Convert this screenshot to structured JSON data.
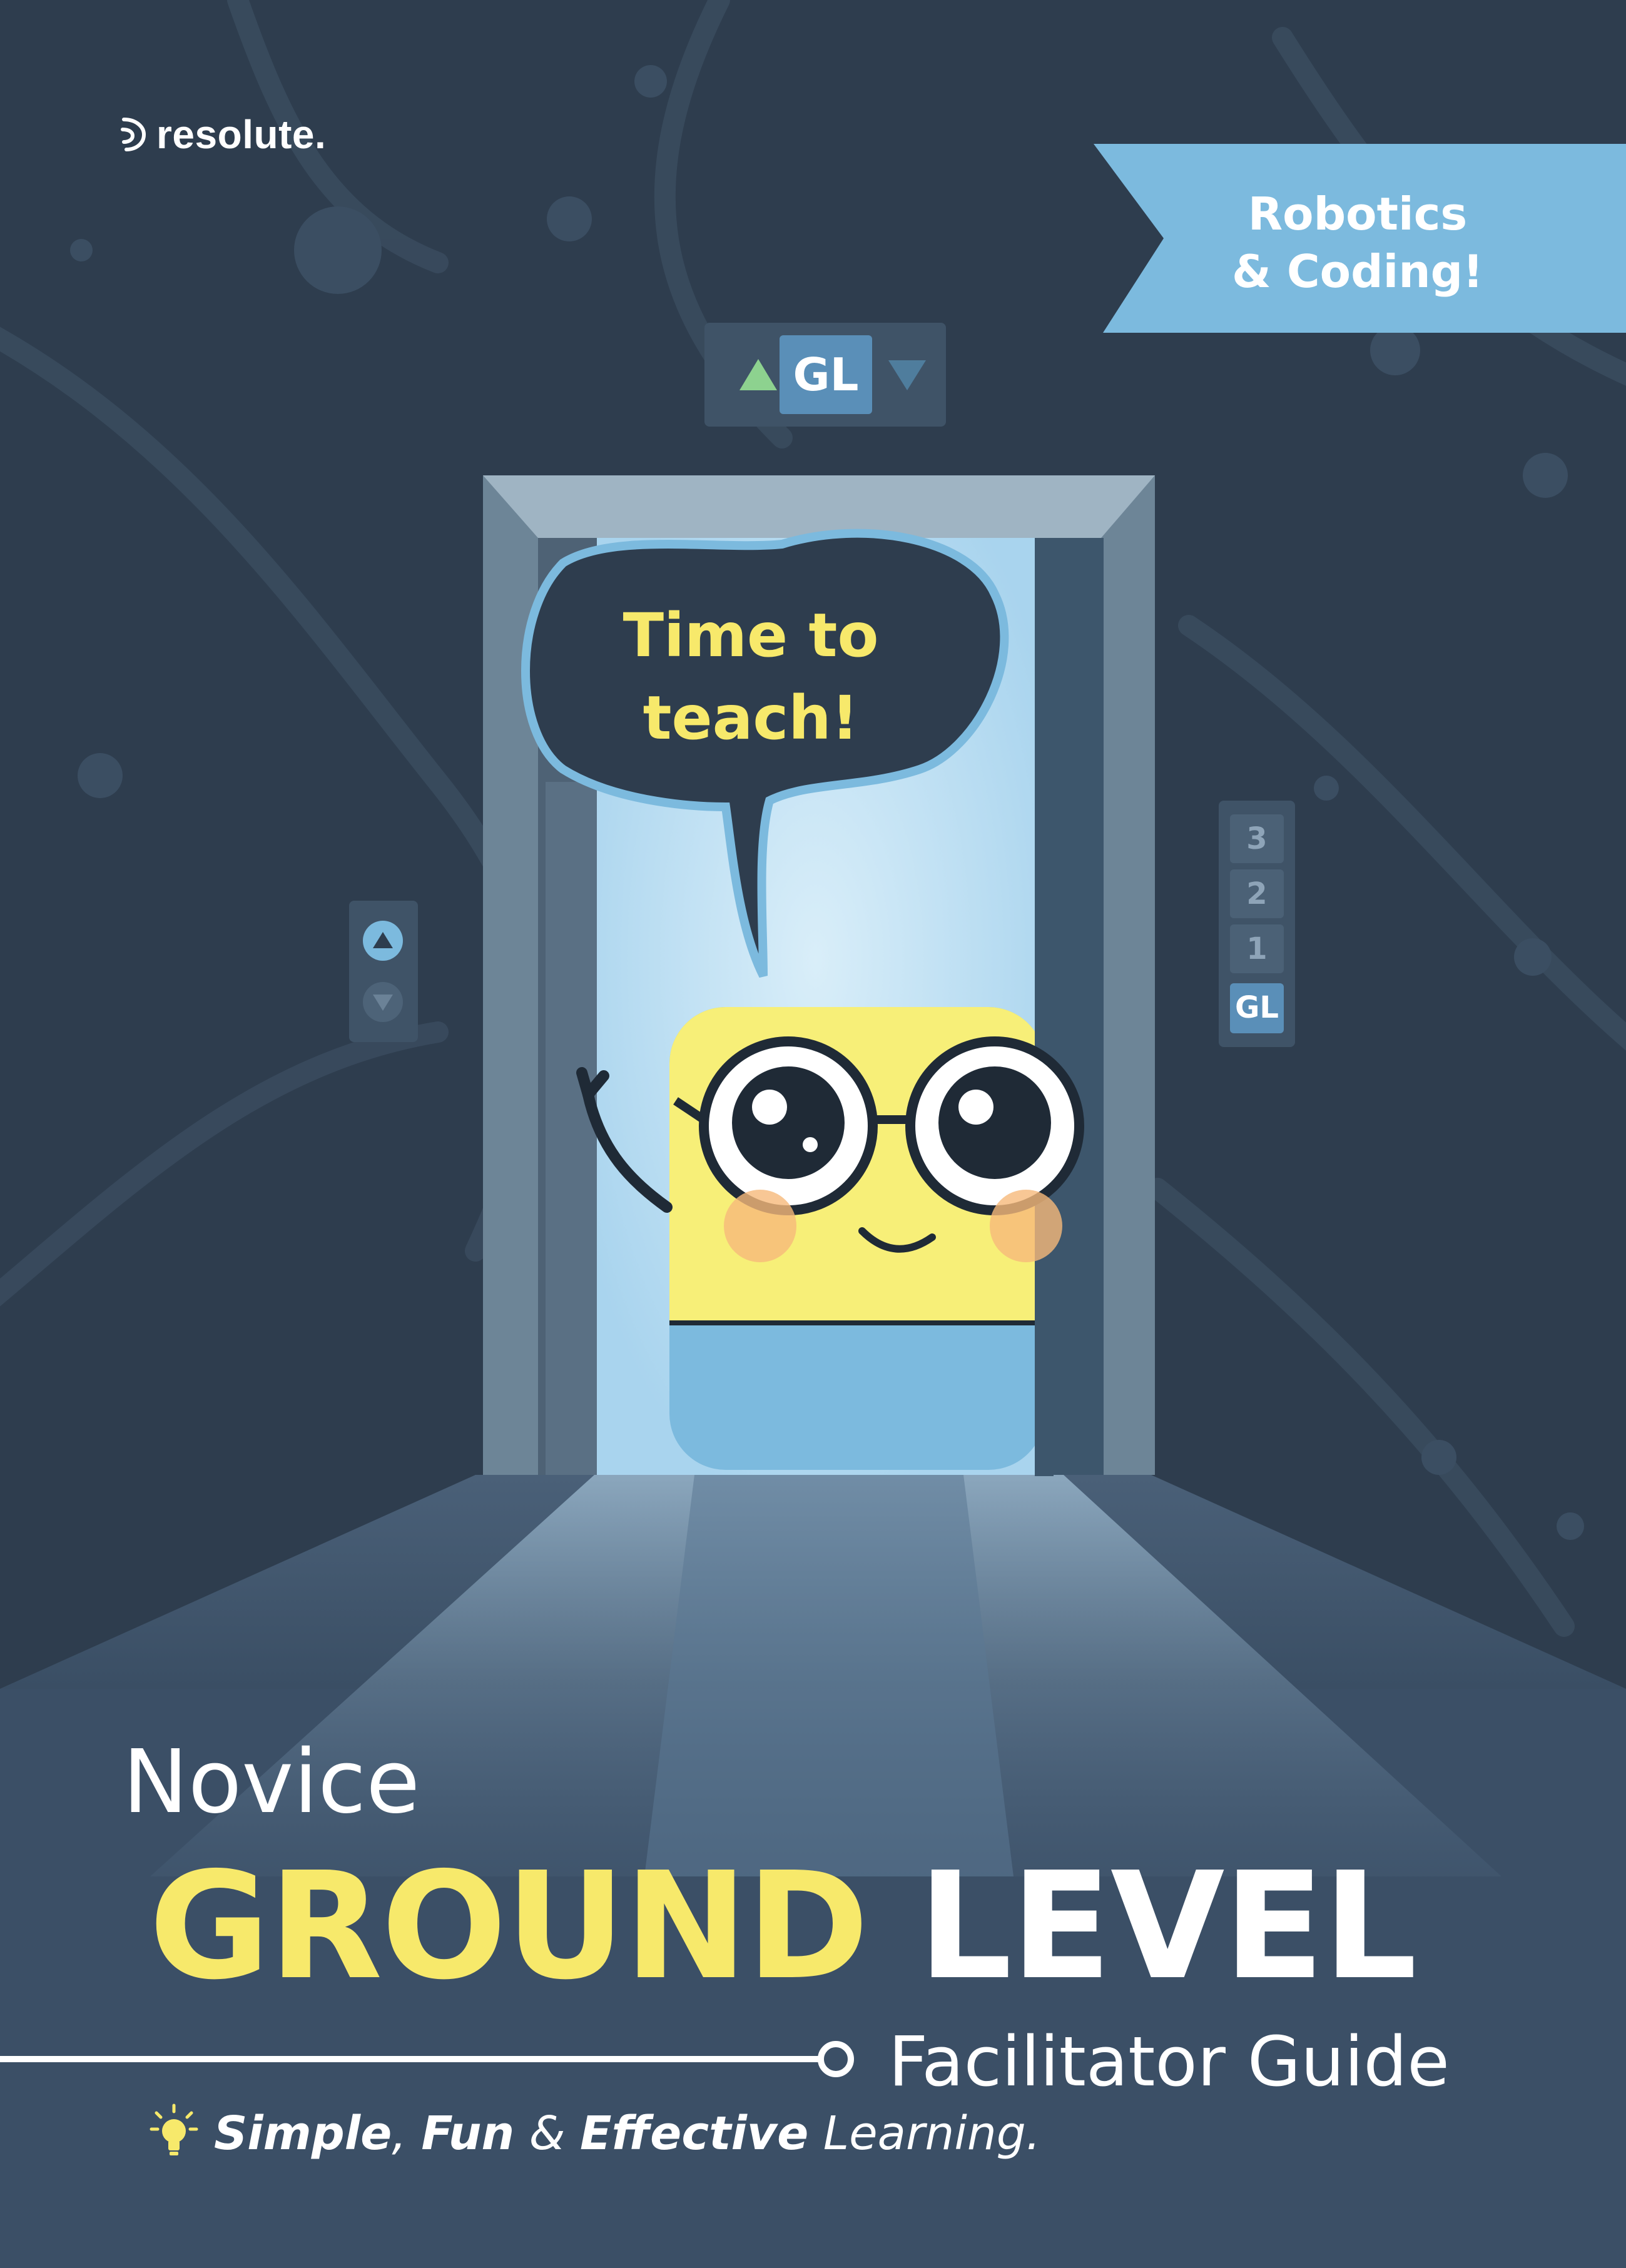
{
  "brand": {
    "logo_text": "resolute."
  },
  "ribbon": {
    "line1": "Robotics",
    "line2": "& Coding!"
  },
  "indicator": {
    "label": "GL"
  },
  "speech_bubble": {
    "line1": "Time to",
    "line2": "teach!"
  },
  "floor_panel": {
    "buttons": [
      "3",
      "2",
      "1",
      "GL"
    ],
    "active": "GL"
  },
  "title": {
    "level": "Novice",
    "headline_part1": "GROUND",
    "headline_part2": "LEVEL",
    "subtitle": "Facilitator Guide"
  },
  "tagline": {
    "word1": "Simple",
    "sep1": ",",
    "word2": "Fun",
    "sep2": "&",
    "word3": "Effective",
    "rest": "Learning."
  },
  "colors": {
    "background": "#2e3d4e",
    "accent_yellow": "#f7e96b",
    "accent_blue": "#7cbade",
    "light_blue": "#c3e3f5"
  },
  "icons": [
    "logo-icon",
    "up-arrow-icon",
    "down-arrow-icon",
    "lightbulb-icon"
  ]
}
